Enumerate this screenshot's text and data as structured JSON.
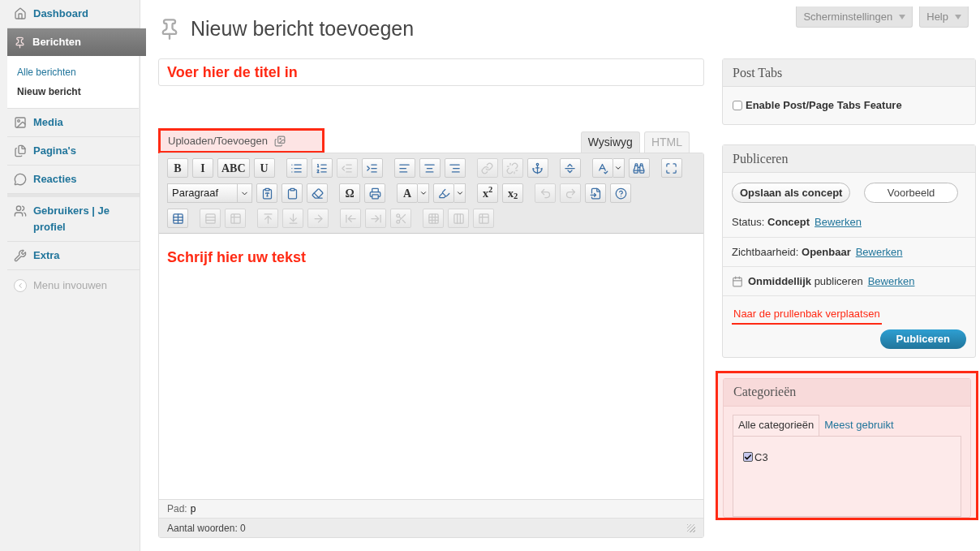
{
  "sidebar": {
    "items": [
      {
        "label": "Dashboard",
        "kind": "item",
        "selected": false
      },
      {
        "label": "Berichten",
        "kind": "item",
        "selected": true,
        "children": [
          {
            "label": "Alle berichten",
            "selected": false
          },
          {
            "label": "Nieuw bericht",
            "selected": true
          }
        ]
      },
      {
        "label": "Media",
        "kind": "item",
        "selected": false
      },
      {
        "label": "Pagina's",
        "kind": "item",
        "selected": false
      },
      {
        "label": "Reacties",
        "kind": "item",
        "selected": false
      },
      {
        "label": "Gebruikers | Je profiel",
        "kind": "item",
        "selected": false
      },
      {
        "label": "Extra",
        "kind": "item",
        "selected": false
      },
      {
        "label": "Menu invouwen",
        "kind": "collapse",
        "selected": false
      }
    ]
  },
  "top_buttons": [
    "Scherminstellingen",
    "Help"
  ],
  "page_title": "Nieuw bericht toevoegen",
  "title_field": {
    "value": "Voer hier de titel in"
  },
  "upload": {
    "label": "Uploaden/Toevoegen"
  },
  "editor_tabs": [
    {
      "label": "Wysiwyg",
      "selected": true
    },
    {
      "label": "HTML",
      "selected": false
    }
  ],
  "toolbar": [
    [
      {
        "kind": "glyph",
        "label": "B",
        "disabled": false
      },
      {
        "kind": "glyph",
        "label": "I",
        "disabled": false
      },
      {
        "kind": "glyph",
        "label": "ABC",
        "disabled": false
      },
      {
        "kind": "glyph",
        "label": "U",
        "disabled": false
      },
      {
        "kind": "gap"
      },
      {
        "kind": "icon",
        "disabled": false
      },
      {
        "kind": "icon",
        "disabled": false
      },
      {
        "kind": "icon",
        "disabled": true
      },
      {
        "kind": "icon",
        "disabled": false
      },
      {
        "kind": "gap"
      },
      {
        "kind": "icon",
        "disabled": false
      },
      {
        "kind": "icon",
        "disabled": false
      },
      {
        "kind": "icon",
        "disabled": false
      },
      {
        "kind": "gap"
      },
      {
        "kind": "icon",
        "disabled": true
      },
      {
        "kind": "icon",
        "disabled": true
      },
      {
        "kind": "icon",
        "disabled": false
      },
      {
        "kind": "gap"
      },
      {
        "kind": "icon",
        "disabled": false
      },
      {
        "kind": "gap"
      },
      {
        "kind": "icon",
        "disabled": false,
        "dropdown": true
      },
      {
        "kind": "icon",
        "disabled": false
      },
      {
        "kind": "gap"
      },
      {
        "kind": "icon",
        "disabled": false
      }
    ],
    [
      {
        "kind": "select",
        "label": "Paragraaf"
      },
      {
        "kind": "icon",
        "disabled": false
      },
      {
        "kind": "icon",
        "disabled": false
      },
      {
        "kind": "icon",
        "disabled": false
      },
      {
        "kind": "gap"
      },
      {
        "kind": "glyph",
        "label": "Ω",
        "disabled": false
      },
      {
        "kind": "icon",
        "disabled": false
      },
      {
        "kind": "gap"
      },
      {
        "kind": "glyph",
        "label": "A",
        "disabled": false,
        "dropdown": true
      },
      {
        "kind": "icon",
        "disabled": false,
        "dropdown": true
      },
      {
        "kind": "gap"
      },
      {
        "kind": "glyph",
        "label": "x$^{2}$",
        "disabled": false
      },
      {
        "kind": "glyph",
        "label": "x$_{2}$",
        "disabled": false
      },
      {
        "kind": "gap"
      },
      {
        "kind": "icon",
        "disabled": true
      },
      {
        "kind": "icon",
        "disabled": true
      },
      {
        "kind": "icon",
        "disabled": false
      },
      {
        "kind": "icon",
        "disabled": false
      }
    ],
    [
      {
        "kind": "icon",
        "disabled": false
      },
      {
        "kind": "gap"
      },
      {
        "kind": "icon",
        "disabled": true
      },
      {
        "kind": "icon",
        "disabled": true
      },
      {
        "kind": "gap"
      },
      {
        "kind": "icon",
        "disabled": true
      },
      {
        "kind": "icon",
        "disabled": true
      },
      {
        "kind": "icon",
        "disabled": true
      },
      {
        "kind": "gap"
      },
      {
        "kind": "icon",
        "disabled": true
      },
      {
        "kind": "icon",
        "disabled": true
      },
      {
        "kind": "icon",
        "disabled": true
      },
      {
        "kind": "gap"
      },
      {
        "kind": "icon",
        "disabled": true
      },
      {
        "kind": "icon",
        "disabled": true
      },
      {
        "kind": "icon",
        "disabled": true
      }
    ]
  ],
  "editor_body": "Schrijf hier uw tekst",
  "path": {
    "label": "Pad:",
    "value": "p"
  },
  "word_count": "Aantal woorden: 0",
  "post_tabs": {
    "title": "Post Tabs",
    "option": {
      "label": "Enable Post/Page Tabs Feature",
      "checked": false
    }
  },
  "publish": {
    "title": "Publiceren",
    "save_button": "Opslaan als concept",
    "preview_button": "Voorbeeld",
    "rows": [
      {
        "kind": "status",
        "label": "Status:",
        "value": "Concept",
        "link": "Bewerken"
      },
      {
        "kind": "visibility",
        "label": "Zichtbaarheid:",
        "value": "Openbaar",
        "link": "Bewerken"
      },
      {
        "kind": "schedule",
        "value": "Onmiddellijk",
        "label": "publiceren",
        "link": "Bewerken"
      }
    ],
    "trash_link": "Naar de prullenbak verplaatsen",
    "publish_button": "Publiceren"
  },
  "categories": {
    "title": "Categorieën",
    "tabs": [
      {
        "label": "Alle categorieën",
        "selected": true
      },
      {
        "label": "Meest gebruikt",
        "selected": false
      }
    ],
    "items": [
      {
        "label": "C3",
        "checked": true
      }
    ]
  }
}
